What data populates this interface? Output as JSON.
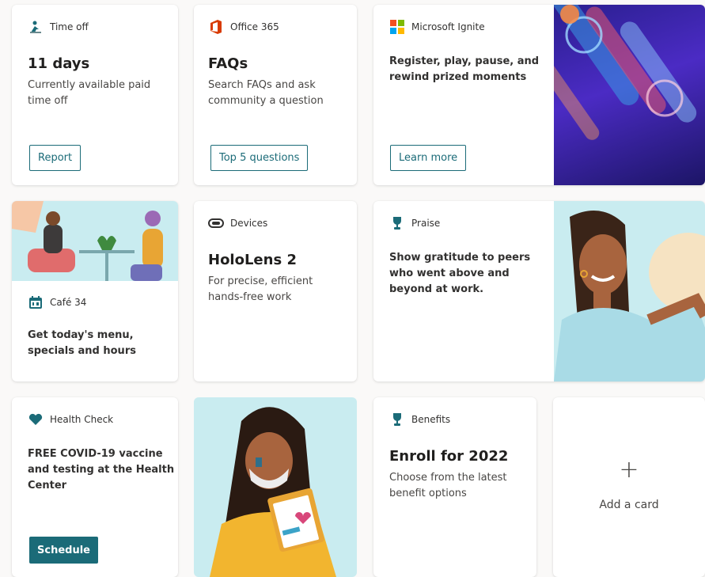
{
  "cards": {
    "timeoff": {
      "category": "Time off",
      "title": "11 days",
      "desc": "Currently available paid time off",
      "button": "Report"
    },
    "office": {
      "category": "Office 365",
      "title": "FAQs",
      "desc": "Search FAQs and ask community a question",
      "button": "Top 5 questions"
    },
    "ignite": {
      "category": "Microsoft Ignite",
      "desc": "Register, play, pause, and rewind prized moments",
      "button": "Learn more"
    },
    "cafe": {
      "category": "Café 34",
      "desc": "Get today's menu, specials and hours"
    },
    "devices": {
      "category": "Devices",
      "title": "HoloLens 2",
      "desc": "For precise, efficient hands-free work"
    },
    "praise": {
      "category": "Praise",
      "desc": "Show gratitude to peers who went above and beyond at work."
    },
    "health": {
      "category": "Health Check",
      "desc": "FREE COVID-19 vaccine and testing at the Health Center",
      "button": "Schedule"
    },
    "benefits": {
      "category": "Benefits",
      "title": "Enroll for 2022",
      "desc": "Choose from the latest benefit options"
    },
    "add": {
      "plus": "+",
      "label": "Add a card"
    }
  },
  "colors": {
    "accent": "#1b6b78",
    "brand_office": "#d83b01"
  },
  "icons": {
    "timeoff": "person-beach-icon",
    "office": "office-logo-icon",
    "ignite": "microsoft-logo-icon",
    "cafe": "calendar-food-icon",
    "devices": "hololens-icon",
    "praise": "trophy-icon",
    "health": "heart-icon",
    "benefits": "trophy-icon"
  }
}
